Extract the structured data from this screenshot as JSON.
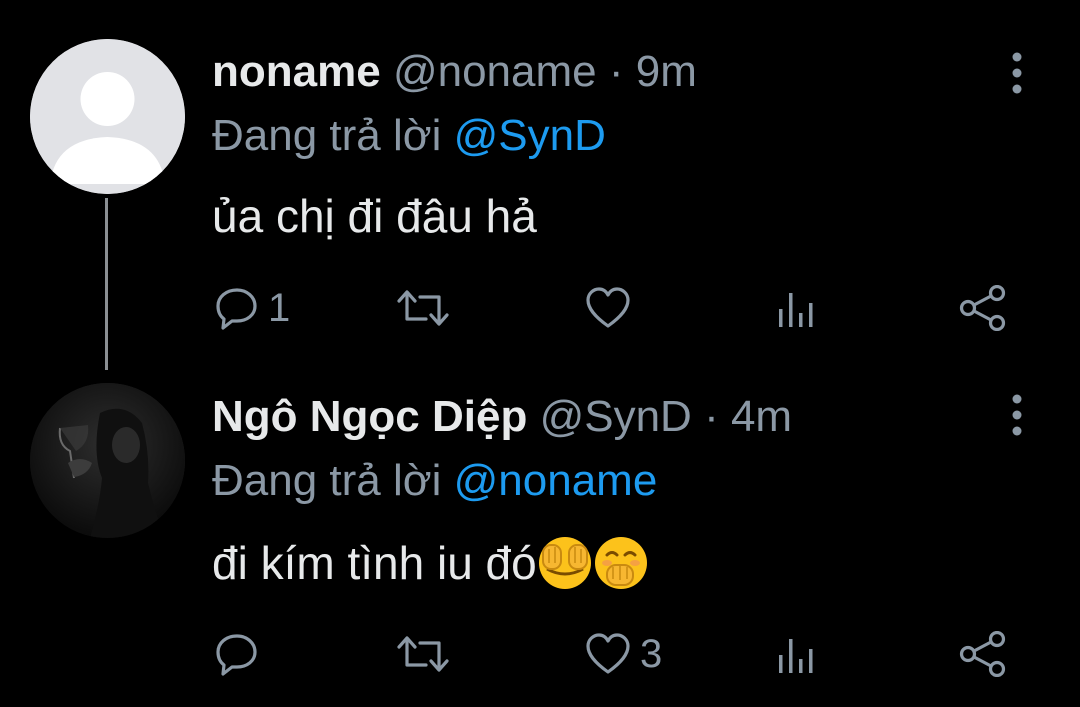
{
  "tweets": [
    {
      "display_name": "noname",
      "handle": "@noname",
      "separator": "·",
      "time": "9m",
      "reply_prefix": "Đang trả lời",
      "reply_to": "@SynD",
      "text": "ủa chị đi đâu hả",
      "emojis": [],
      "reply_count": "1",
      "retweet_count": "",
      "like_count": "",
      "avatar": "default-avatar"
    },
    {
      "display_name": "Ngô Ngọc Diệp",
      "handle": "@SynD",
      "separator": "·",
      "time": "4m",
      "reply_prefix": "Đang trả lời",
      "reply_to": "@noname",
      "text": "đi kím tình iu đó",
      "emojis": [
        "face-with-hands-over-eyes",
        "face-with-hand-over-mouth"
      ],
      "reply_count": "",
      "retweet_count": "",
      "like_count": "3",
      "avatar": "photo-avatar"
    }
  ],
  "icons": {
    "reply": "reply-icon",
    "retweet": "retweet-icon",
    "like": "heart-icon",
    "stats": "stats-icon",
    "share": "share-icon",
    "more": "more-vertical-icon"
  },
  "colors": {
    "background": "#000000",
    "text": "#e7e9ea",
    "secondary": "#8b98a5",
    "mention": "#1d9bf0",
    "thread_line": "#8b8f93"
  }
}
